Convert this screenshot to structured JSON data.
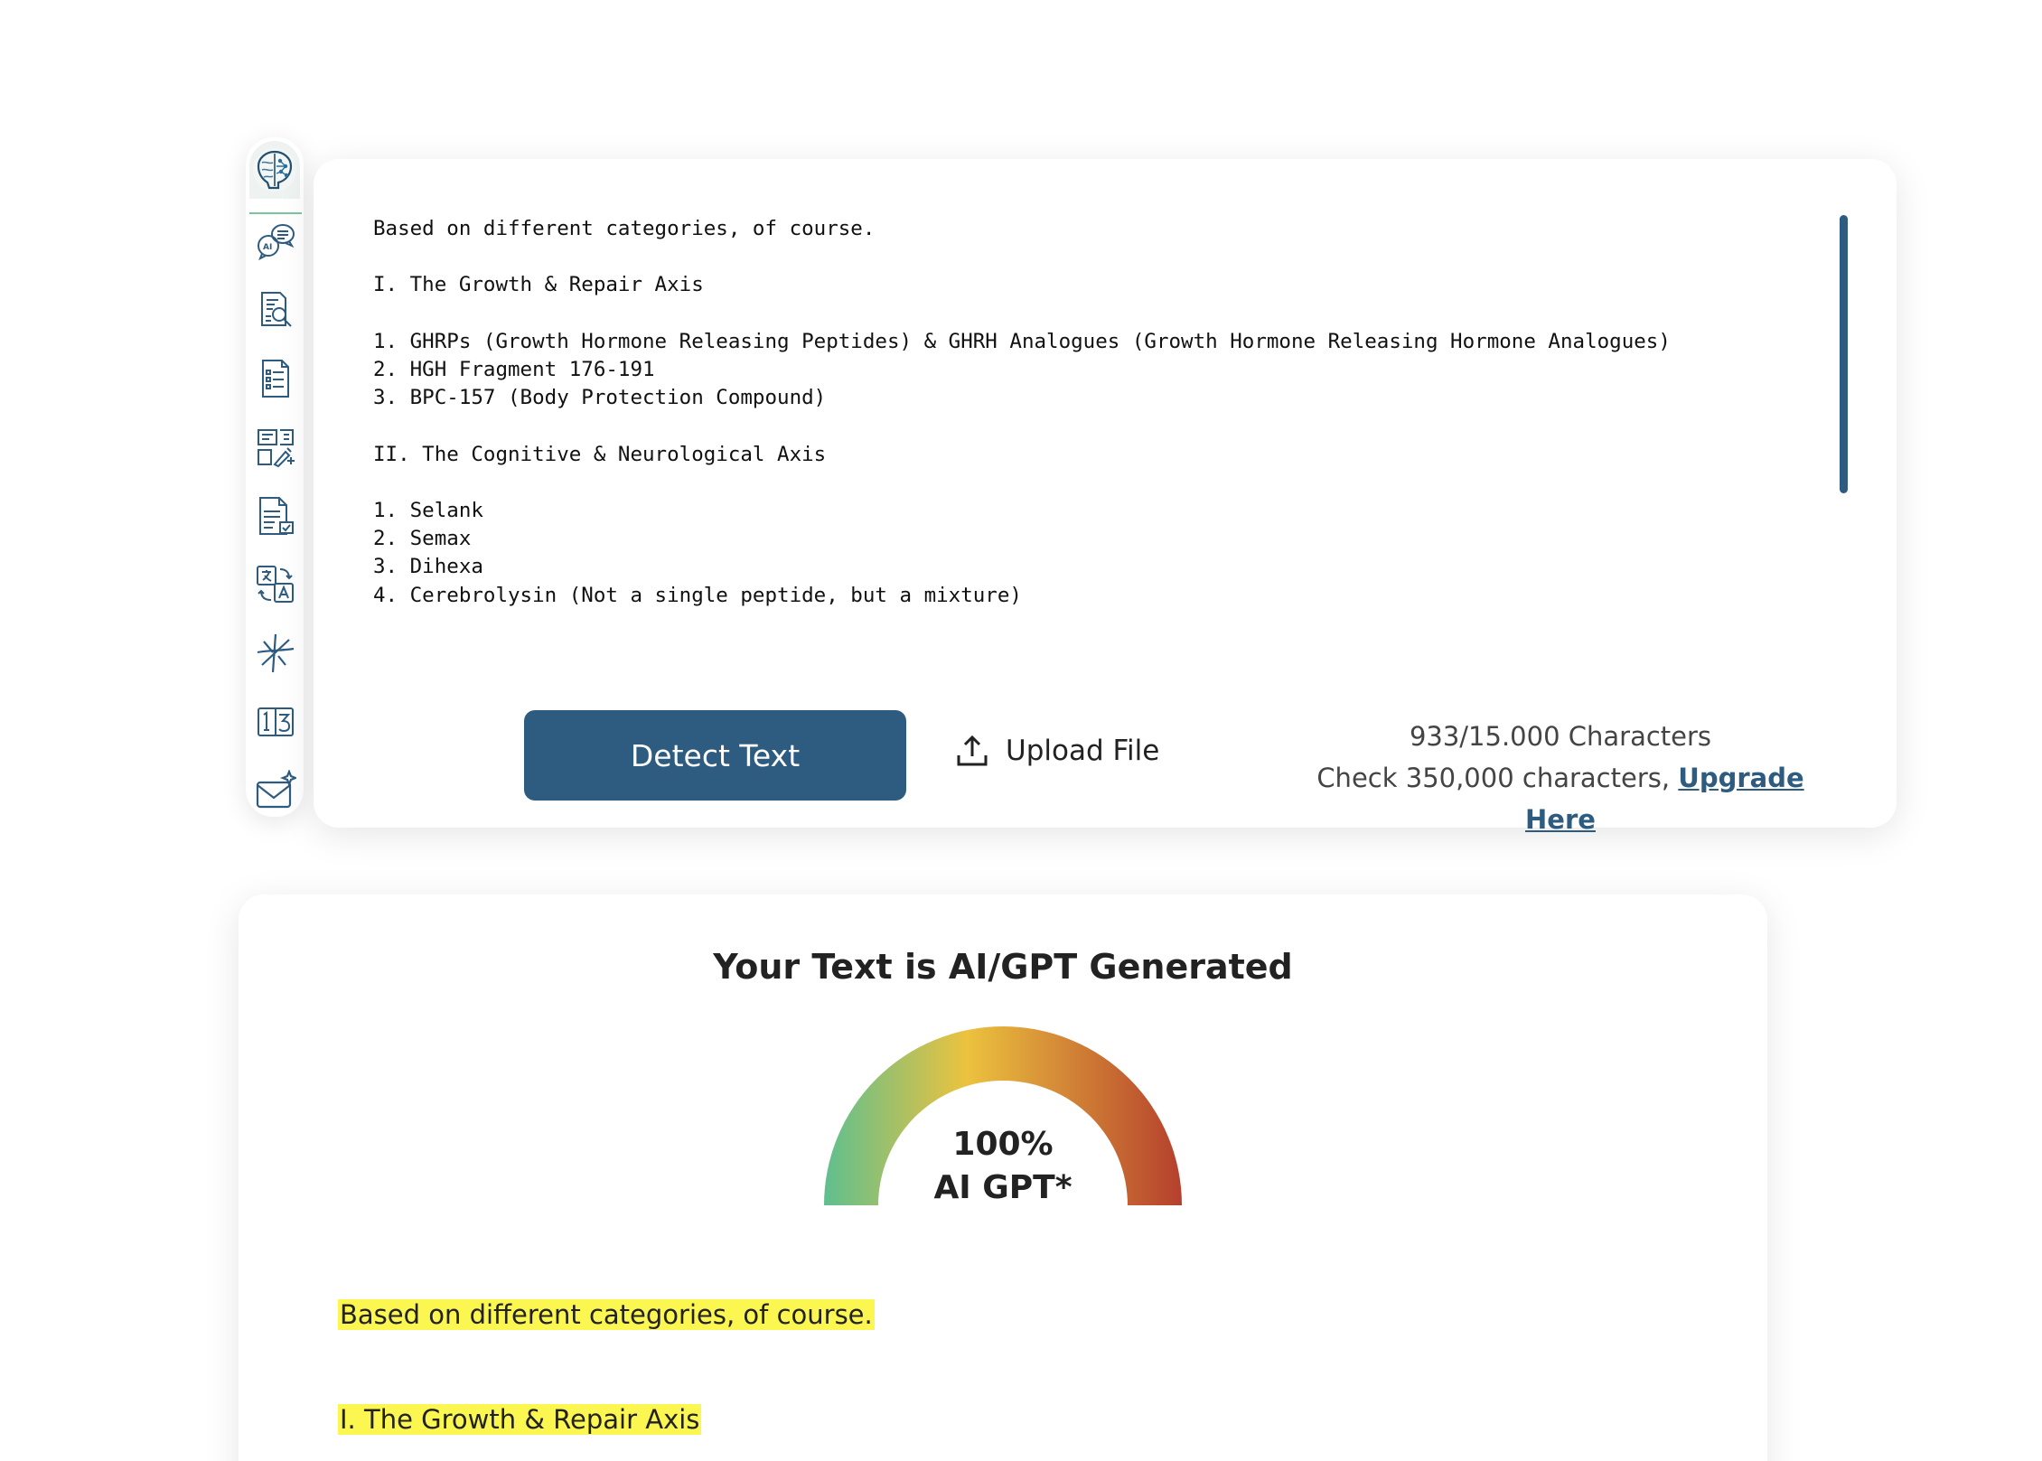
{
  "sidebar": {
    "logo": "brain-logo-icon",
    "items": [
      {
        "icon": "ai-chat-icon"
      },
      {
        "icon": "document-search-icon"
      },
      {
        "icon": "document-list-icon"
      },
      {
        "icon": "text-tools-icon"
      },
      {
        "icon": "document-check-icon"
      },
      {
        "icon": "translate-icon"
      },
      {
        "icon": "split-text-icon"
      },
      {
        "icon": "word-counter-icon"
      },
      {
        "icon": "mail-sparkle-icon"
      }
    ]
  },
  "editor": {
    "text": "Based on different categories, of course.\n\nI. The Growth & Repair Axis\n\n1. GHRPs (Growth Hormone Releasing Peptides) & GHRH Analogues (Growth Hormone Releasing Hormone Analogues)\n2. HGH Fragment 176-191\n3. BPC-157 (Body Protection Compound)\n\nII. The Cognitive & Neurological Axis\n\n1. Selank\n2. Semax\n3. Dihexa\n4. Cerebrolysin (Not a single peptide, but a mixture)\n\nIII. The Metabolic & Longevity Axis",
    "detect_label": "Detect Text",
    "upload_label": "Upload File",
    "char_count": "933/15.000 Characters",
    "check_prefix": "Check 350,000 characters, ",
    "upgrade_label": "Upgrade Here"
  },
  "result": {
    "title": "Your Text is AI/GPT Generated",
    "percent": "100%",
    "percent_value": 100,
    "label": "AI GPT*",
    "highlights": [
      "Based on different categories, of course.",
      "I. The Growth & Repair Axis"
    ]
  },
  "colors": {
    "primary": "#2d5c80",
    "highlight": "#fbf650",
    "gauge_start": "#5fbf8f",
    "gauge_mid": "#ecc23e",
    "gauge_end": "#b5402d"
  }
}
